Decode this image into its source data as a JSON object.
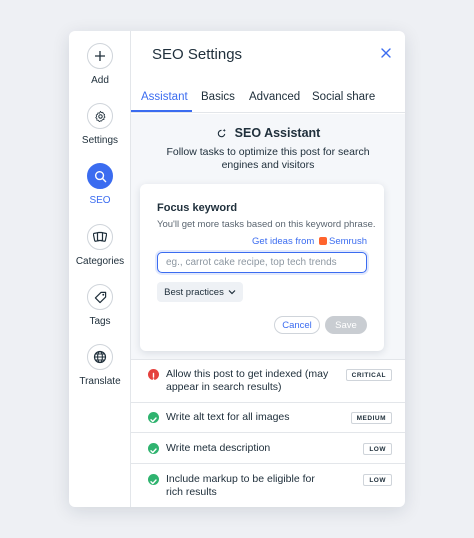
{
  "sidebar": {
    "items": [
      {
        "label": "Add",
        "icon": "plus-icon"
      },
      {
        "label": "Settings",
        "icon": "gear-icon"
      },
      {
        "label": "SEO",
        "icon": "search-icon",
        "active": true
      },
      {
        "label": "Categories",
        "icon": "categories-icon"
      },
      {
        "label": "Tags",
        "icon": "tag-icon"
      },
      {
        "label": "Translate",
        "icon": "globe-icon"
      }
    ]
  },
  "header": {
    "title": "SEO Settings",
    "close_icon": "close-icon"
  },
  "tabs": [
    {
      "label": "Assistant",
      "active": true
    },
    {
      "label": "Basics"
    },
    {
      "label": "Advanced"
    },
    {
      "label": "Social share"
    }
  ],
  "assistant": {
    "heading": "SEO Assistant",
    "description": "Follow tasks to optimize this post for search engines and visitors"
  },
  "focus": {
    "title": "Focus keyword",
    "subtitle": "You'll get more tasks based on this keyword phrase.",
    "ideas_prefix": "Get ideas from",
    "ideas_brand": "Semrush",
    "input_value": "",
    "placeholder": "eg., carrot cake recipe, top tech trends",
    "best_practices": "Best practices",
    "cancel": "Cancel",
    "save": "Save"
  },
  "tasks": [
    {
      "text": "Allow this post to get indexed (may appear in search results)",
      "badge": "CRITICAL",
      "status": "error"
    },
    {
      "text": "Write alt text for all images",
      "badge": "MEDIUM",
      "status": "done"
    },
    {
      "text": "Write meta description",
      "badge": "LOW",
      "status": "done"
    },
    {
      "text": "Include markup to be eligible for rich results",
      "badge": "LOW",
      "status": "done"
    }
  ],
  "colors": {
    "accent": "#3b6cf0",
    "success": "#2fb36f",
    "error": "#e5413e",
    "semrush": "#ff642d"
  }
}
